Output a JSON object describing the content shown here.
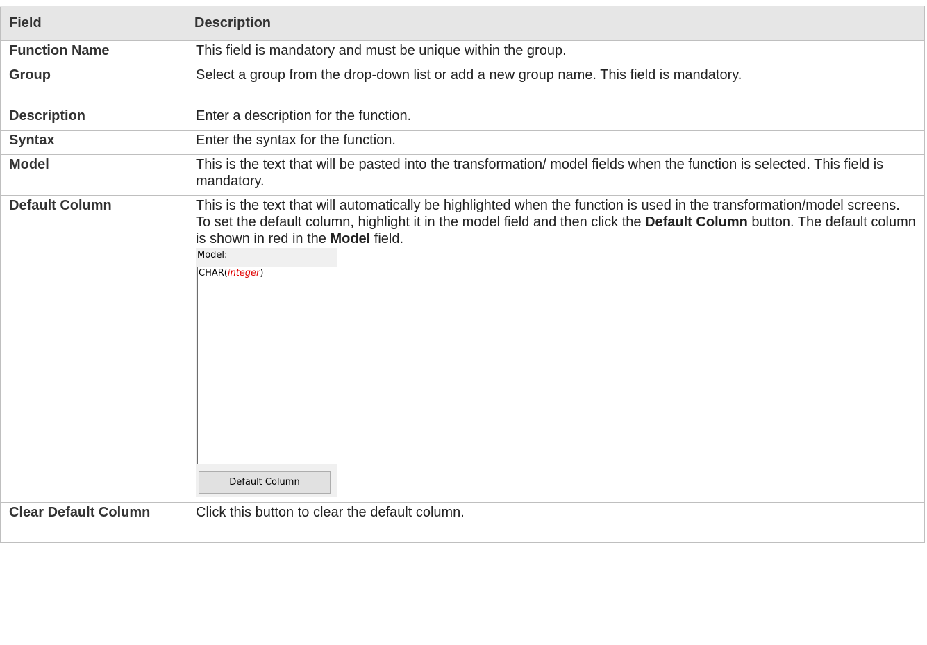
{
  "table": {
    "headers": [
      "Field",
      "Description"
    ],
    "rows": [
      {
        "field": "Function Name",
        "description": "This field is mandatory and must be unique within the group."
      },
      {
        "field": "Group",
        "description": "Select a group from the drop-down list or add a new group name. This field is mandatory."
      },
      {
        "field": "Description",
        "description": "Enter a description for the function."
      },
      {
        "field": "Syntax",
        "description": "Enter the syntax for the function."
      },
      {
        "field": "Model",
        "description": "This is the text that will be pasted into the transformation/ model fields when the function is selected. This field is mandatory."
      },
      {
        "field": "Default Column",
        "description_parts": [
          "This is the text that will automatically be highlighted when the function is used in the transformation/model screens. To set the default column, highlight it in the model field and then click the ",
          "Default Column",
          " button. The default column is shown in red in the ",
          "Model",
          " field."
        ],
        "screenshot": {
          "label": "Model:",
          "text_prefix": "CHAR(",
          "text_highlight": "integer",
          "text_suffix": ")",
          "highlight_color": "#e00000",
          "button_label": "Default Column"
        }
      },
      {
        "field": "Clear Default Column",
        "description": "Click this button to clear the default column."
      }
    ]
  }
}
